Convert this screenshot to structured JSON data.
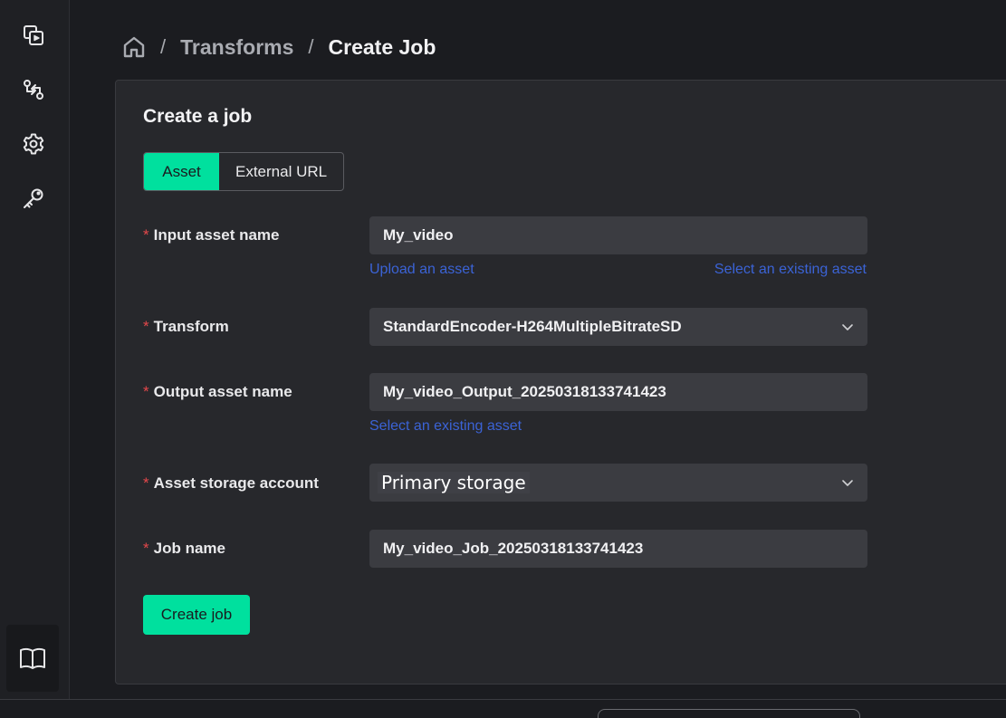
{
  "breadcrumb": {
    "home_icon": "home-icon",
    "sep1": "/",
    "transforms": "Transforms",
    "sep2": "/",
    "current": "Create Job"
  },
  "sidebar": {
    "items": [
      {
        "icon": "media-assets-icon"
      },
      {
        "icon": "transforms-icon"
      },
      {
        "icon": "settings-gear-icon"
      },
      {
        "icon": "key-icon"
      }
    ],
    "bottom_icon": "book-icon"
  },
  "form": {
    "title": "Create a job",
    "source_tabs": [
      "Asset",
      "External URL"
    ],
    "active_tab": "Asset",
    "required_marker": "*",
    "fields": {
      "input_asset": {
        "label": "Input asset name",
        "value": "My_video"
      },
      "transform": {
        "label": "Transform",
        "value": "StandardEncoder-H264MultipleBitrateSD"
      },
      "output_asset": {
        "label": "Output asset name",
        "value": "My_video_Output_20250318133741423"
      },
      "storage": {
        "label": "Asset storage account",
        "value": "Primary storage"
      },
      "job_name": {
        "label": "Job name",
        "value": "My_video_Job_20250318133741423"
      }
    },
    "links": {
      "upload_asset": "Upload an asset",
      "select_existing_input": "Select an existing asset",
      "select_existing_output": "Select an existing asset"
    },
    "submit_label": "Create job"
  },
  "colors": {
    "accent": "#00e09e",
    "required": "#e4484b",
    "link": "#3b63d6"
  }
}
